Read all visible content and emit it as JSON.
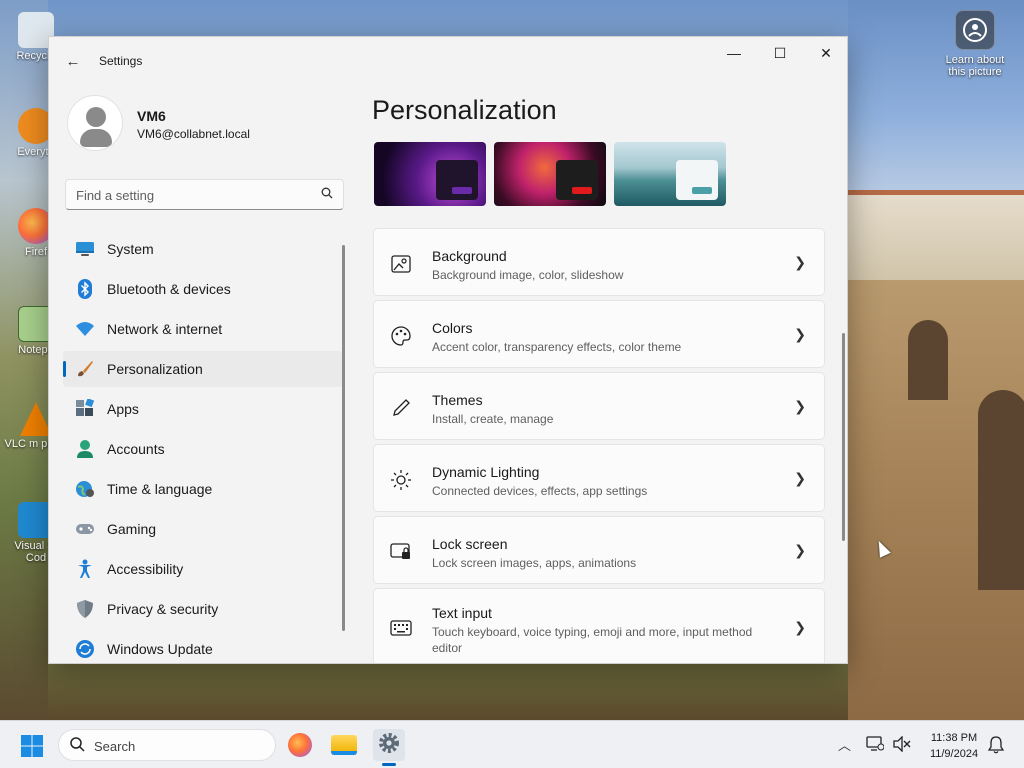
{
  "window": {
    "app_title": "Settings",
    "back_label": "←",
    "minimize_label": "—",
    "maximize_label": "☐",
    "close_label": "✕"
  },
  "profile": {
    "name": "VM6",
    "email": "VM6@collabnet.local"
  },
  "search": {
    "placeholder": "Find a setting"
  },
  "nav": {
    "items": [
      {
        "label": "System",
        "icon": "monitor-icon"
      },
      {
        "label": "Bluetooth & devices",
        "icon": "bluetooth-icon"
      },
      {
        "label": "Network & internet",
        "icon": "wifi-icon"
      },
      {
        "label": "Personalization",
        "icon": "brush-icon",
        "active": true
      },
      {
        "label": "Apps",
        "icon": "apps-icon"
      },
      {
        "label": "Accounts",
        "icon": "person-icon"
      },
      {
        "label": "Time & language",
        "icon": "globe-clock-icon"
      },
      {
        "label": "Gaming",
        "icon": "gamepad-icon"
      },
      {
        "label": "Accessibility",
        "icon": "accessibility-icon"
      },
      {
        "label": "Privacy & security",
        "icon": "shield-icon"
      },
      {
        "label": "Windows Update",
        "icon": "update-icon"
      }
    ]
  },
  "main": {
    "title": "Personalization",
    "cards": [
      {
        "title": "Background",
        "subtitle": "Background image, color, slideshow",
        "icon": "image-icon"
      },
      {
        "title": "Colors",
        "subtitle": "Accent color, transparency effects, color theme",
        "icon": "palette-icon"
      },
      {
        "title": "Themes",
        "subtitle": "Install, create, manage",
        "icon": "pen-icon"
      },
      {
        "title": "Dynamic Lighting",
        "subtitle": "Connected devices, effects, app settings",
        "icon": "lighting-icon"
      },
      {
        "title": "Lock screen",
        "subtitle": "Lock screen images, apps, animations",
        "icon": "lock-screen-icon"
      },
      {
        "title": "Text input",
        "subtitle": "Touch keyboard, voice typing, emoji and more, input method editor",
        "icon": "keyboard-icon"
      }
    ]
  },
  "desktop": {
    "learn_label": "Learn about this picture",
    "icons": [
      {
        "label": "Recycle",
        "icon": "recycle-bin-icon"
      },
      {
        "label": "Everyth",
        "icon": "everything-search-icon"
      },
      {
        "label": "Firef",
        "icon": "firefox-icon"
      },
      {
        "label": "Notepa",
        "icon": "notepad-icon"
      },
      {
        "label": "VLC m playe",
        "icon": "vlc-icon"
      },
      {
        "label": "Visual St Cod",
        "icon": "vscode-icon"
      }
    ]
  },
  "taskbar": {
    "search_placeholder": "Search",
    "time": "11:38 PM",
    "date": "11/9/2024"
  },
  "colors": {
    "accent": "#0067c0",
    "window_bg": "#f3f3f3",
    "card_bg": "#fbfbfb"
  }
}
